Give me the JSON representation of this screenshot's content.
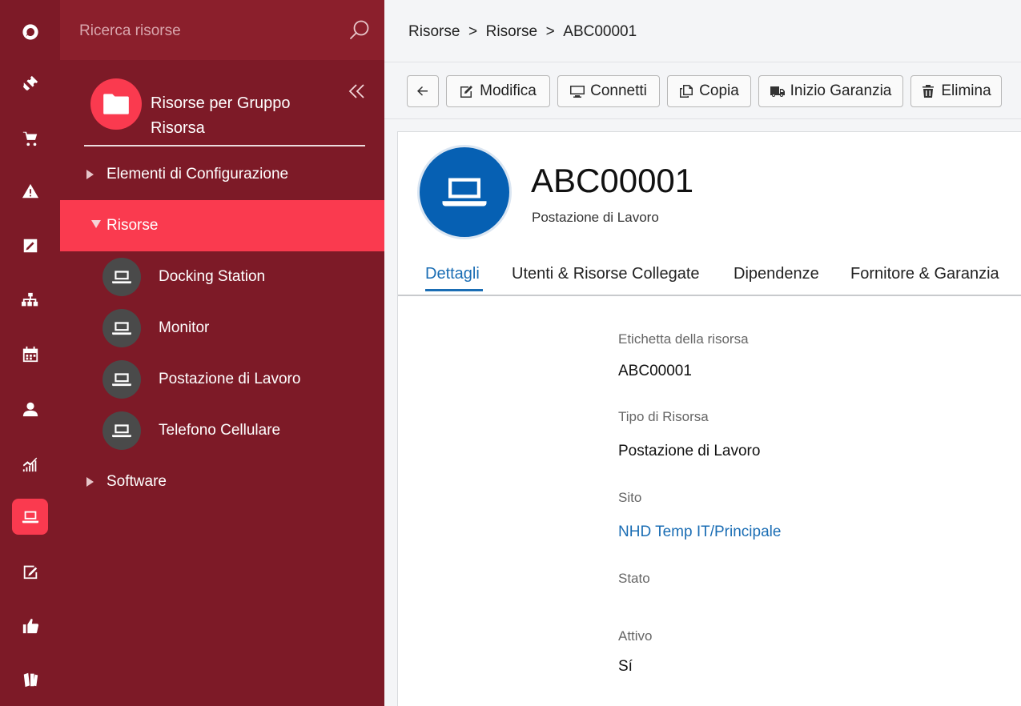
{
  "sidebar": {
    "search_placeholder": "Ricerca risorse",
    "group_title": "Risorse per Gruppo Risorsa",
    "tree": [
      {
        "label": "Elementi di Configurazione",
        "state": "collapsed"
      },
      {
        "label": "Risorse",
        "state": "expanded"
      },
      {
        "label": "Software",
        "state": "collapsed"
      }
    ],
    "leaves": [
      {
        "label": "Docking Station"
      },
      {
        "label": "Monitor"
      },
      {
        "label": "Postazione di Lavoro"
      },
      {
        "label": "Telefono Cellulare"
      }
    ]
  },
  "rail": {
    "icons": [
      "logo-icon",
      "ticket-icon",
      "cart-icon",
      "warning-icon",
      "edit-icon",
      "org-chart-icon",
      "calendar-icon",
      "user-icon",
      "chart-icon",
      "laptop-icon",
      "note-edit-icon",
      "thumbs-up-icon",
      "books-icon"
    ],
    "active": "laptop-icon"
  },
  "breadcrumb": [
    "Risorse",
    "Risorse",
    "ABC00001"
  ],
  "breadcrumb_separator": ">",
  "toolbar": {
    "modifica": "Modifica",
    "connetti": "Connetti",
    "copia": "Copia",
    "inizio_garanzia": "Inizio Garanzia",
    "elimina": "Elimina"
  },
  "resource": {
    "title": "ABC00001",
    "subtitle": "Postazione di Lavoro"
  },
  "tabs": [
    {
      "label": "Dettagli",
      "active": true
    },
    {
      "label": "Utenti & Risorse Collegate"
    },
    {
      "label": "Dipendenze"
    },
    {
      "label": "Fornitore & Garanzia"
    }
  ],
  "fields": [
    {
      "label": "Etichetta della risorsa",
      "value": "ABC00001"
    },
    {
      "label": "Tipo di Risorsa",
      "value": "Postazione di Lavoro"
    },
    {
      "label": "Sito",
      "value": "NHD Temp IT/Principale"
    },
    {
      "label": "Stato",
      "value": ""
    },
    {
      "label": "Attivo",
      "value": "Sí"
    }
  ],
  "colors": {
    "sidebar_bg": "#7d1a27",
    "accent": "#fa3a4f",
    "link": "#1a6db4",
    "avatar": "#0660b3"
  }
}
